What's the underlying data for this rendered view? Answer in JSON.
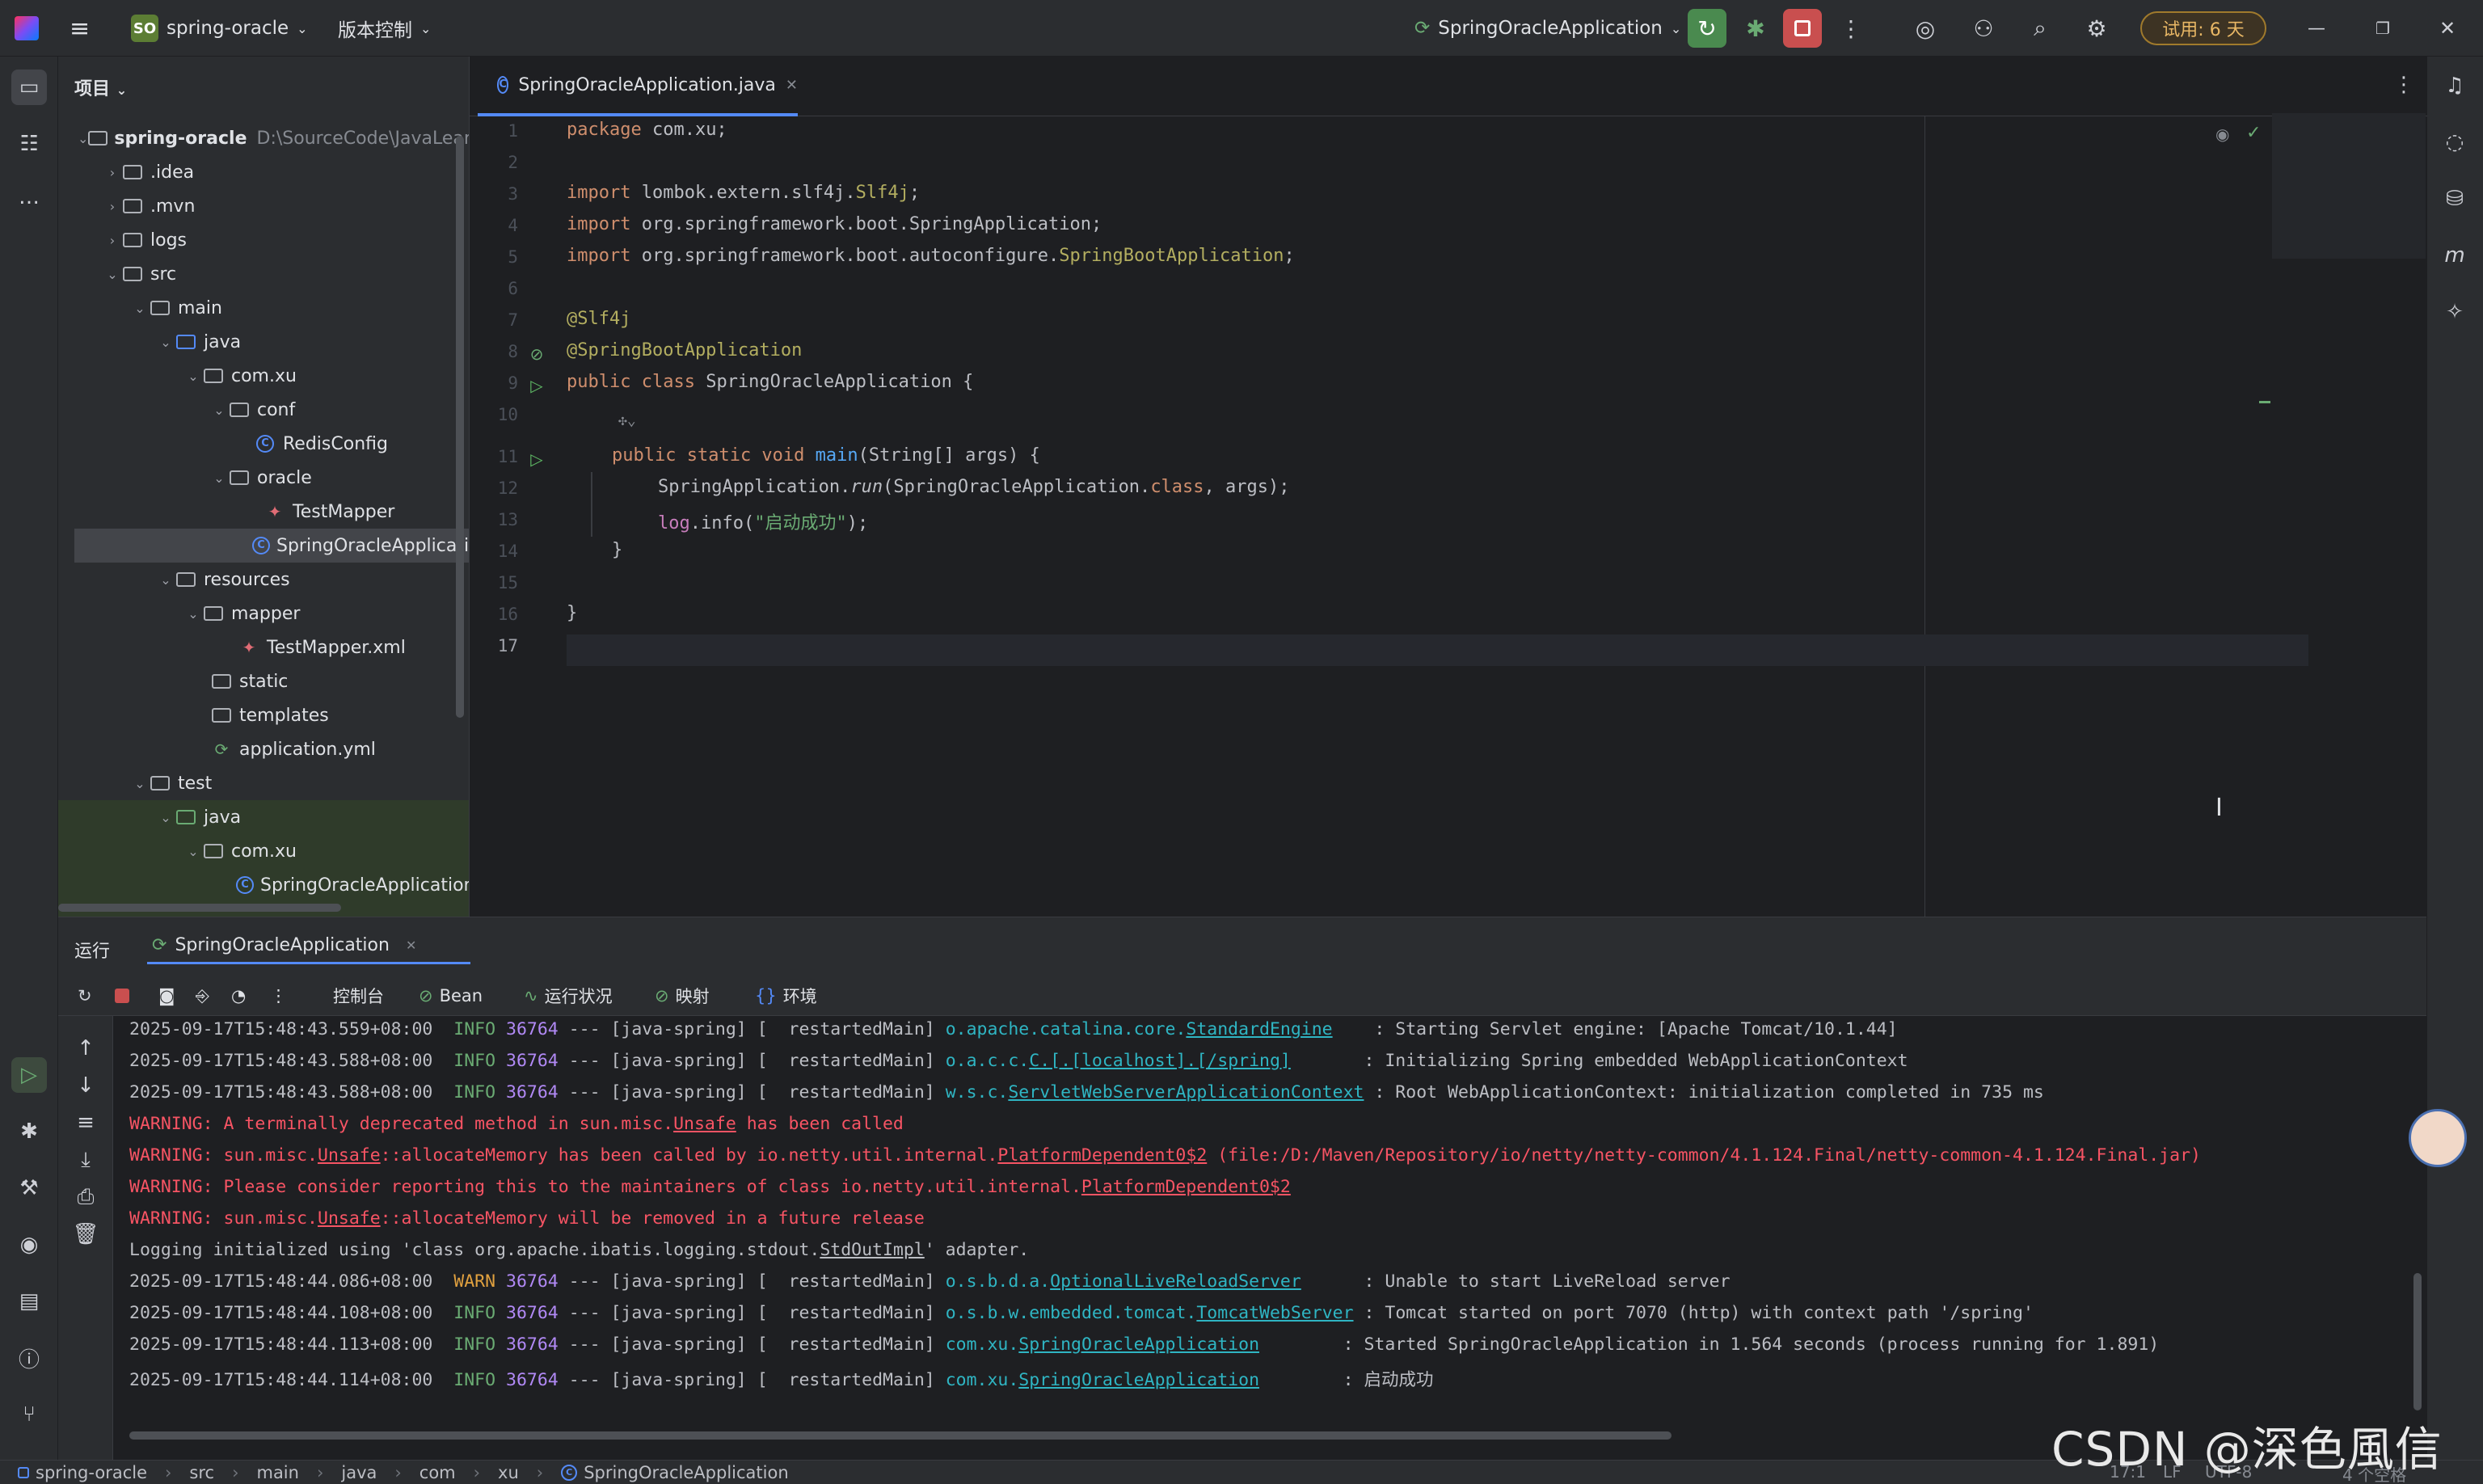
{
  "titlebar": {
    "project_badge": "SO",
    "project_name": "spring-oracle",
    "vcs": "版本控制",
    "run_config": "SpringOracleApplication",
    "trial": "试用: 6 天"
  },
  "project_panel": {
    "title": "项目",
    "root_name": "spring-oracle",
    "root_path": "D:\\SourceCode\\JavaLearn\\",
    "items": [
      {
        "label": ".idea"
      },
      {
        "label": ".mvn"
      },
      {
        "label": "logs"
      },
      {
        "label": "src"
      },
      {
        "label": "main"
      },
      {
        "label": "java"
      },
      {
        "label": "com.xu"
      },
      {
        "label": "conf"
      },
      {
        "label": "RedisConfig"
      },
      {
        "label": "oracle"
      },
      {
        "label": "TestMapper"
      },
      {
        "label": "SpringOracleApplication"
      },
      {
        "label": "resources"
      },
      {
        "label": "mapper"
      },
      {
        "label": "TestMapper.xml"
      },
      {
        "label": "static"
      },
      {
        "label": "templates"
      },
      {
        "label": "application.yml"
      },
      {
        "label": "test"
      },
      {
        "label": "java"
      },
      {
        "label": "com.xu"
      },
      {
        "label": "SpringOracleApplicationT"
      }
    ]
  },
  "editor": {
    "tab": "SpringOracleApplication.java",
    "lines": [
      "1",
      "2",
      "3",
      "4",
      "5",
      "6",
      "7",
      "8",
      "9",
      "10",
      "11",
      "12",
      "13",
      "14",
      "15",
      "16",
      "17"
    ],
    "code": {
      "l1_kw": "package",
      "l1": " com.xu;",
      "l3_kw": "import",
      "l3": " lombok.extern.slf4j.",
      "l3_ann": "Slf4j",
      "l3_end": ";",
      "l4_kw": "import",
      "l4": " org.springframework.boot.SpringApplication;",
      "l5_kw": "import",
      "l5": " org.springframework.boot.autoconfigure.",
      "l5_ann": "SpringBootApplication",
      "l5_end": ";",
      "l7": "@Slf4j",
      "l8": "@SpringBootApplication",
      "l9_kw": "public class",
      "l9": " SpringOracleApplication {",
      "l11_kw": "public static void",
      "l11_fn": "main",
      "l11": "(String[] args) {",
      "l12_a": "SpringApplication.",
      "l12_run": "run",
      "l12_b": "(SpringOracleApplication.",
      "l12_cls": "class",
      "l12_c": ", args);",
      "l13_log": "log",
      "l13_a": ".info(",
      "l13_str": "\"启动成功\"",
      "l13_b": ");",
      "l14": "}",
      "l16": "}"
    }
  },
  "run_panel": {
    "tab_run": "运行",
    "tab_app": "SpringOracleApplication",
    "toolbar": [
      "控制台",
      "Bean",
      "运行状况",
      "映射",
      "环境"
    ],
    "logs": [
      {
        "ts": "2025-09-17T15:48:43.559+08:00",
        "lvl": "INFO",
        "pid": "36764",
        "mid": " --- [java-spring] [  restartedMain] ",
        "logger_pre": "o.apache.catalina.core.",
        "logger_cls": "StandardEngine",
        "pad": "    ",
        "msg": ": Starting Servlet engine: [Apache Tomcat/10.1.44]"
      },
      {
        "ts": "2025-09-17T15:48:43.588+08:00",
        "lvl": "INFO",
        "pid": "36764",
        "mid": " --- [java-spring] [  restartedMain] ",
        "logger_pre": "o.a.c.c.",
        "logger_cls": "C.[.[localhost].[/spring]",
        "pad": "       ",
        "msg": ": Initializing Spring embedded WebApplicationContext"
      },
      {
        "ts": "2025-09-17T15:48:43.588+08:00",
        "lvl": "INFO",
        "pid": "36764",
        "mid": " --- [java-spring] [  restartedMain] ",
        "logger_pre": "w.s.c.",
        "logger_cls": "ServletWebServerApplicationContext",
        "pad": " ",
        "msg": ": Root WebApplicationContext: initialization completed in 735 ms"
      },
      {
        "warn": "WARNING: A terminally deprecated method in sun.misc.",
        "warn_u": "Unsafe",
        "warn_end": " has been called"
      },
      {
        "warn": "WARNING: sun.misc.",
        "warn_u": "Unsafe",
        "warn_end": "::allocateMemory has been called by io.netty.util.internal.",
        "warn_u2": "PlatformDependent0$2",
        "warn_end2": " (file:/D:/Maven/Repository/io/netty/netty-common/4.1.124.Final/netty-common-4.1.124.Final.jar)"
      },
      {
        "warn": "WARNING: Please consider reporting this to the maintainers of class io.netty.util.internal.",
        "warn_u": "PlatformDependent0$2",
        "warn_end": ""
      },
      {
        "warn": "WARNING: sun.misc.",
        "warn_u": "Unsafe",
        "warn_end": "::allocateMemory will be removed in a future release"
      },
      {
        "plain": "Logging initialized using 'class org.apache.ibatis.logging.stdout.",
        "plain_u": "StdOutImpl",
        "plain_end": "' adapter."
      },
      {
        "ts": "2025-09-17T15:48:44.086+08:00",
        "lvl": "WARN",
        "pid": "36764",
        "mid": " --- [java-spring] [  restartedMain] ",
        "logger_pre": "o.s.b.d.a.",
        "logger_cls": "OptionalLiveReloadServer",
        "pad": "      ",
        "msg": ": Unable to start LiveReload server"
      },
      {
        "ts": "2025-09-17T15:48:44.108+08:00",
        "lvl": "INFO",
        "pid": "36764",
        "mid": " --- [java-spring] [  restartedMain] ",
        "logger_pre": "o.s.b.w.embedded.tomcat.",
        "logger_cls": "TomcatWebServer",
        "pad": " ",
        "msg": ": Tomcat started on port 7070 (http) with context path '/spring'"
      },
      {
        "ts": "2025-09-17T15:48:44.113+08:00",
        "lvl": "INFO",
        "pid": "36764",
        "mid": " --- [java-spring] [  restartedMain] ",
        "logger_pre": "com.xu.",
        "logger_cls": "SpringOracleApplication",
        "pad": "        ",
        "msg": ": Started SpringOracleApplication in 1.564 seconds (process running for 1.891)"
      },
      {
        "ts": "2025-09-17T15:48:44.114+08:00",
        "lvl": "INFO",
        "pid": "36764",
        "mid": " --- [java-spring] [  restartedMain] ",
        "logger_pre": "com.xu.",
        "logger_cls": "SpringOracleApplication",
        "pad": "        ",
        "msg": ": 启动成功"
      }
    ]
  },
  "statusbar": {
    "crumbs": [
      "spring-oracle",
      "src",
      "main",
      "java",
      "com",
      "xu",
      "SpringOracleApplication"
    ],
    "pos": "17:1",
    "lf": "LF",
    "enc": "UTF-8",
    "indent": "4 个空格"
  },
  "watermark": "CSDN @深色風信子"
}
